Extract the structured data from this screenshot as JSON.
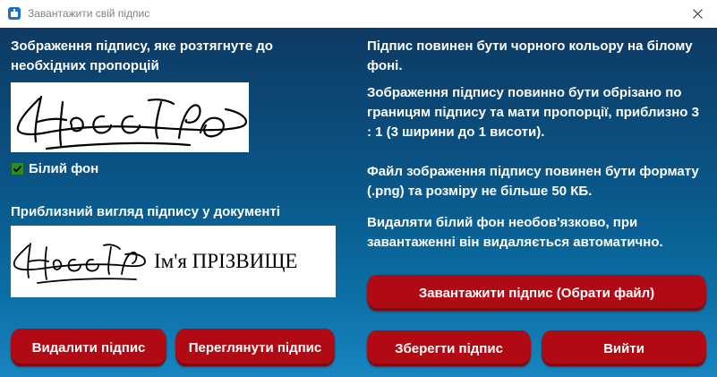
{
  "window": {
    "title": "Завантажити свій підпис"
  },
  "left": {
    "stretched_caption": "Зображення підпису, яке розтягнуте до необхідних пропорцій",
    "white_bg_checkbox": {
      "label": "Білий фон",
      "checked": true
    },
    "preview_caption": "Приблизний вигляд підпису у документі",
    "document_name": "Ім'я ПРІЗВИЩЕ"
  },
  "right": {
    "rules": [
      "Підпис повинен бути чорного кольору на білому фоні.",
      "Зображення підпису повинно бути обрізано по границям підпису та мати пропорції, приблизно 3 : 1 (3 ширини до 1 висоти).",
      "Файл зображення підпису повинен бути формату (.png) та розміру не більше 50 КБ.",
      "Видаляти білий фон необов'язково, при завантаженні він видаляється автоматично."
    ]
  },
  "buttons": {
    "upload": "Завантажити підпис (Обрати файл)",
    "delete": "Видалити підпис",
    "view": "Переглянути підпис",
    "save": "Зберегти підпис",
    "exit": "Вийти"
  },
  "colors": {
    "button": "#b00b14",
    "background_top": "#0d3a63",
    "background_bottom": "#1886c0",
    "checkbox": "#2b8a2b"
  },
  "icons": {
    "app": "app-icon",
    "close": "close-icon",
    "check": "check-icon"
  }
}
